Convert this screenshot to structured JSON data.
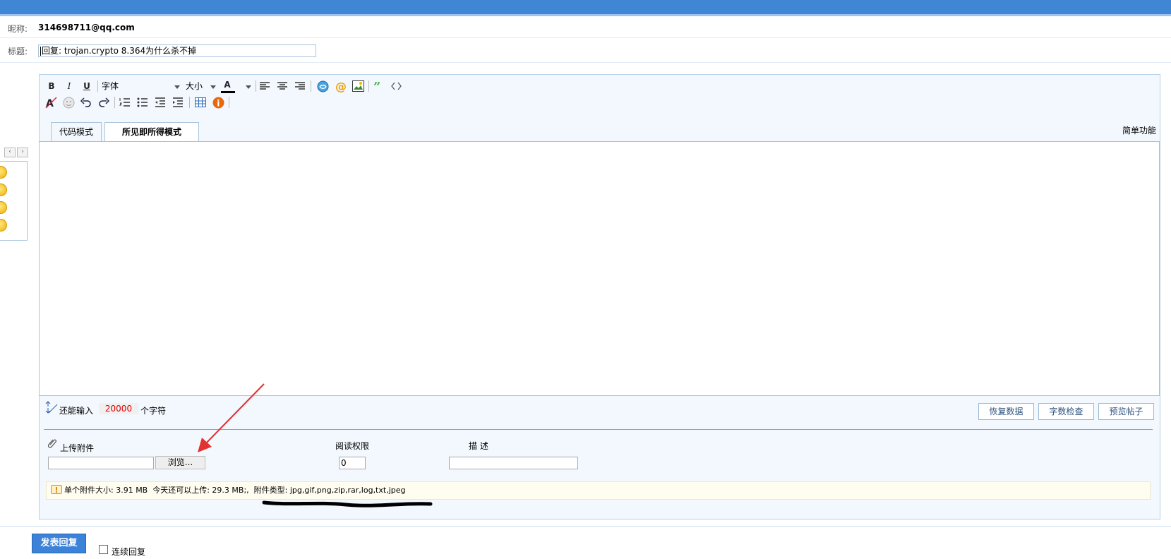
{
  "header": {
    "nickname_label": "昵称:",
    "nickname_value": "314698711@qq.com",
    "subject_label": "标题:",
    "subject_value": "回复: trojan.crypto 8.364为什么杀不掉"
  },
  "toolbar": {
    "bold": "B",
    "italic": "I",
    "underline": "U",
    "font_select": "字体",
    "size_select": "大小",
    "color_letter": "A"
  },
  "tabs": {
    "code_mode": "代码模式",
    "wysiwyg_mode": "所见即所得模式",
    "simple_mode": "简单功能"
  },
  "editor": {
    "remaining_prefix": "还能输入",
    "remaining_count": "20000",
    "remaining_suffix": "个字符",
    "restore_button": "恢复数据",
    "wordcount_button": "字数检查",
    "preview_button": "预览帖子"
  },
  "attachment": {
    "upload_label": "上传附件",
    "browse_button": "浏览...",
    "read_perm_label": "阅读权限",
    "read_perm_value": "0",
    "description_label": "描 述",
    "notice_text": "单个附件大小: 3.91 MB  今天还可以上传: 29.3 MB;,  附件类型: jpg,gif,png,zip,rar,log,txt,jpeg"
  },
  "footer": {
    "submit_button": "发表回复",
    "continuous_reply_label": "连续回复"
  },
  "colors": {
    "topbar": "#3f86d4",
    "editor_bg": "#f2f8fd",
    "border": "#a9c3dc",
    "remaining_count": "#e00000",
    "submit_bg": "#3b82d8"
  }
}
